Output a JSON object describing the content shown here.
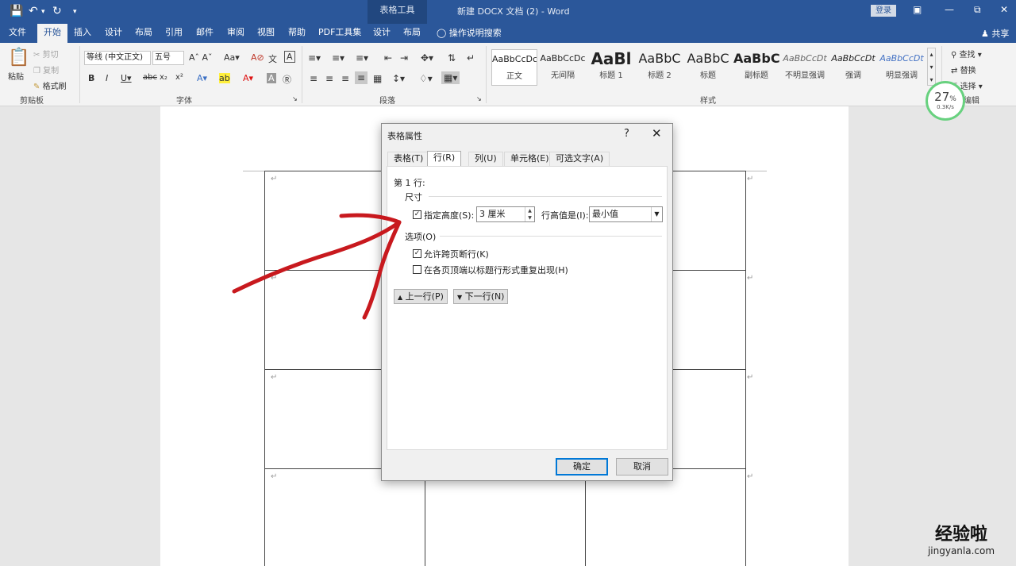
{
  "titlebar": {
    "context_tools": "表格工具",
    "doc_title": "新建 DOCX 文档 (2)  -  Word",
    "login": "登录",
    "qat_icons": [
      "save-icon",
      "undo-icon",
      "redo-icon",
      "customize-icon"
    ]
  },
  "tabs": {
    "file": "文件",
    "home": "开始",
    "insert": "插入",
    "design": "设计",
    "layout": "布局",
    "references": "引用",
    "mailings": "邮件",
    "review": "审阅",
    "view": "视图",
    "help": "帮助",
    "pdf": "PDF工具集",
    "table_design": "设计",
    "table_layout": "布局",
    "tell_me": "操作说明搜索",
    "share": "共享"
  },
  "ribbon": {
    "clipboard": {
      "label": "剪贴板",
      "paste": "粘贴",
      "cut": "剪切",
      "copy": "复制",
      "format_painter": "格式刷"
    },
    "font": {
      "label": "字体",
      "font_name": "等线 (中文正文)",
      "font_size": "五号"
    },
    "paragraph": {
      "label": "段落"
    },
    "styles": {
      "label": "样式",
      "items": [
        {
          "sample": "AaBbCcDc",
          "name": "正文"
        },
        {
          "sample": "AaBbCcDc",
          "name": "无间隔"
        },
        {
          "sample": "AaBl",
          "name": "标题 1"
        },
        {
          "sample": "AaBbC",
          "name": "标题 2"
        },
        {
          "sample": "AaBbC",
          "name": "标题"
        },
        {
          "sample": "AaBbC",
          "name": "副标题"
        },
        {
          "sample": "AaBbCcDt",
          "name": "不明显强调"
        },
        {
          "sample": "AaBbCcDt",
          "name": "强调"
        },
        {
          "sample": "AaBbCcDt",
          "name": "明显强调"
        }
      ]
    },
    "editing": {
      "find": "查找",
      "replace": "替换",
      "select": "选择",
      "label": "编辑"
    }
  },
  "speed_widget": {
    "percent": "27",
    "unit": "%",
    "rate": "0.3K/s"
  },
  "dialog": {
    "title": "表格属性",
    "help": "?",
    "tabs": [
      "表格(T)",
      "行(R)",
      "列(U)",
      "单元格(E)",
      "可选文字(A)"
    ],
    "row_heading": "第 1 行:",
    "size_section": "尺寸",
    "specify_height_label": "指定高度(S):",
    "specify_height_checked": true,
    "height_value": "3 厘米",
    "row_height_is_label": "行高值是(I):",
    "row_height_is_value": "最小值",
    "options_section": "选项(O)",
    "allow_break_label": "允许跨页断行(K)",
    "allow_break_checked": true,
    "repeat_header_label": "在各页顶端以标题行形式重复出现(H)",
    "repeat_header_checked": false,
    "prev_row": "上一行(P)",
    "next_row": "下一行(N)",
    "ok": "确定",
    "cancel": "取消"
  },
  "annotation": {
    "color": "#c8191e"
  },
  "watermark": {
    "text": "经验啦",
    "url": "jingyanla.com"
  }
}
